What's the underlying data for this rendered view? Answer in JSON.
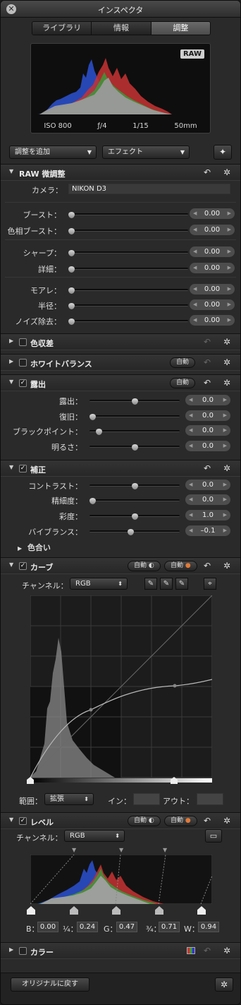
{
  "window": {
    "title": "インスペクタ",
    "close_glyph": "✕"
  },
  "tabs": [
    {
      "label": "ライブラリ",
      "selected": false
    },
    {
      "label": "情報",
      "selected": false
    },
    {
      "label": "調整",
      "selected": true
    }
  ],
  "histogram": {
    "badge": "RAW",
    "iso": "ISO 800",
    "aperture": "ƒ/4",
    "shutter": "1/15",
    "focal": "50mm"
  },
  "toolbar": {
    "add_adjustment": "調整を追加",
    "effects": "エフェクト"
  },
  "raw_fine_tuning": {
    "title": "RAW 微調整",
    "camera_label": "カメラ：",
    "camera_value": "NIKON D3",
    "sliders": [
      {
        "label": "ブースト：",
        "value": "0.00",
        "fraction": 0.0
      },
      {
        "label": "色相ブースト：",
        "value": "0.00",
        "fraction": 0.0
      },
      {
        "label": "シャープ：",
        "value": "0.00",
        "fraction": 0.0
      },
      {
        "label": "詳細：",
        "value": "0.00",
        "fraction": 0.0
      },
      {
        "label": "モアレ：",
        "value": "0.00",
        "fraction": 0.0
      },
      {
        "label": "半径：",
        "value": "0.00",
        "fraction": 0.0
      },
      {
        "label": "ノイズ除去：",
        "value": "0.00",
        "fraction": 0.0
      }
    ]
  },
  "chromatic": {
    "title": "色収差"
  },
  "white_balance": {
    "title": "ホワイトバランス",
    "auto": "自動"
  },
  "exposure": {
    "title": "露出",
    "auto": "自動",
    "sliders": [
      {
        "label": "露出：",
        "value": "0.0",
        "fraction": 0.5
      },
      {
        "label": "復旧：",
        "value": "0.0",
        "fraction": 0.0
      },
      {
        "label": "ブラックポイント：",
        "value": "0.0",
        "fraction": 0.1
      },
      {
        "label": "明るさ：",
        "value": "0.0",
        "fraction": 0.5
      }
    ]
  },
  "enhance": {
    "title": "補正",
    "sliders": [
      {
        "label": "コントラスト：",
        "value": "0.0",
        "fraction": 0.5
      },
      {
        "label": "精細度：",
        "value": "0.0",
        "fraction": 0.0
      },
      {
        "label": "彩度：",
        "value": "1.0",
        "fraction": 0.5
      },
      {
        "label": "バイブランス：",
        "value": "–0.1",
        "fraction": 0.45
      }
    ],
    "tint": "色合い"
  },
  "curves": {
    "title": "カーブ",
    "auto1": "自動",
    "auto2": "自動",
    "channel_label": "チャンネル：",
    "channel_value": "RGB",
    "range_label": "範囲：",
    "range_value": "拡張",
    "in_label": "イン：",
    "out_label": "アウト："
  },
  "levels": {
    "title": "レベル",
    "auto1": "自動",
    "auto2": "自動",
    "channel_label": "チャンネル：",
    "channel_value": "RGB",
    "fields": [
      {
        "label": "B：",
        "value": "0.00"
      },
      {
        "label": "¼：",
        "value": "0.24"
      },
      {
        "label": "G：",
        "value": "0.47"
      },
      {
        "label": "¾：",
        "value": "0.71"
      },
      {
        "label": "W：",
        "value": "0.94"
      }
    ]
  },
  "color": {
    "title": "カラー"
  },
  "footer": {
    "revert": "オリジナルに戻す"
  },
  "icons": {
    "undo": "↶",
    "gear": "✲",
    "wand": "✦"
  },
  "colors": {
    "red": "#c83232",
    "green": "#3a9a3a",
    "blue": "#2a4ec8",
    "gray": "#9a9a9a"
  }
}
